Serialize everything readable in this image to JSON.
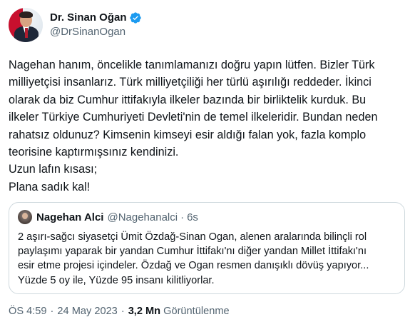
{
  "author": {
    "display_name": "Dr. Sinan Oğan",
    "handle": "@DrSinanOgan",
    "verified_color": "#1d9bf0"
  },
  "tweet": {
    "lines": [
      "Nagehan hanım, öncelikle tanımlamanızı doğru yapın lütfen. Bizler Türk",
      "milliyetçisi insanlarız. Türk milliyetçiliği her türlü aşırılığı reddeder. İkinci",
      "olarak da biz Cumhur ittifakıyla ilkeler bazında bir birliktelik kurduk. Bu",
      "ilkeler Türkiye Cumhuriyeti Devleti'nin de temel ilkeleridir. Bundan neden",
      "rahatsız oldunuz?  Kimsenin kimseyi esir aldığı falan yok, fazla komplo",
      "teorisine kaptırmışsınız kendinizi.",
      "Uzun lafın kısası;",
      "Plana sadık kal!"
    ]
  },
  "quoted": {
    "display_name": "Nagehan Alci",
    "handle": "@Nagehanalci",
    "dot": "·",
    "time": "6s",
    "lines": [
      "2 aşırı-sağcı siyasetçi Ümit Özdağ-Sinan Ogan, alenen aralarında bilinçli rol",
      "paylaşımı yaparak bir yandan Cumhur İttifakı'nı diğer yandan Millet İttifakı'nı",
      "esir etme projesi içindeler. Özdağ ve Ogan resmen danışıklı dövüş yapıyor...",
      "Yüzde 5 oy ile, Yüzde 95 insanı kilitliyorlar."
    ]
  },
  "meta": {
    "time": "ÖS 4:59",
    "separator": "·",
    "date": "24 May 2023",
    "views_count": "3,2 Mn",
    "views_label": "Görüntülenme"
  }
}
